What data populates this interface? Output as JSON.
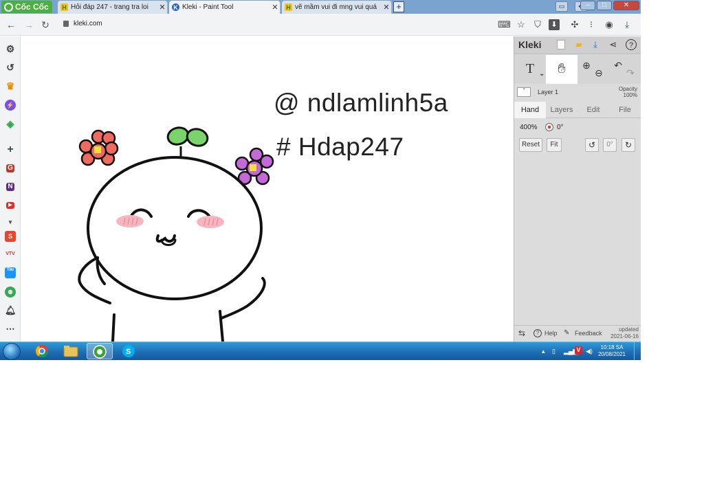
{
  "browser": {
    "brand": "Cốc Cốc",
    "tabs": [
      {
        "title": "Hỏi đáp 247 - trang tra loi",
        "favicon": "H",
        "active": false
      },
      {
        "title": "Kleki - Paint Tool",
        "favicon": "K",
        "active": true
      },
      {
        "title": "vẽ mầm vui đi mng vui quá c",
        "favicon": "H",
        "active": false
      }
    ],
    "close_glyph": "✕",
    "new_tab_glyph": "+",
    "url": "kleki.com"
  },
  "canvas": {
    "line1": "@ ndlamlinh5a",
    "line2": "# Hdap247"
  },
  "kleki": {
    "logo": "Kleki",
    "tool_text": "T",
    "tool_caret": "⌄",
    "layer_name": "Layer 1",
    "opacity_label": "Opacity",
    "opacity_value": "100%",
    "tabs": [
      "Hand",
      "Layers",
      "Edit",
      "File"
    ],
    "zoom": "400%",
    "angle": "0°",
    "reset_label": "Reset",
    "fit_label": "Fit",
    "angle_button": "0°",
    "help_label": "Help",
    "feedback_label": "Feedback",
    "updated_label": "updated",
    "updated_date": "2021-06-16"
  },
  "taskbar": {
    "time": "10:18 SA",
    "date": "20/08/2021"
  },
  "colors": {
    "tabstrip": "#7aa3cf",
    "brand_green": "#4ab13f",
    "kleki_panel": "#dcdcdc",
    "taskbar": "#1f6fb5"
  }
}
